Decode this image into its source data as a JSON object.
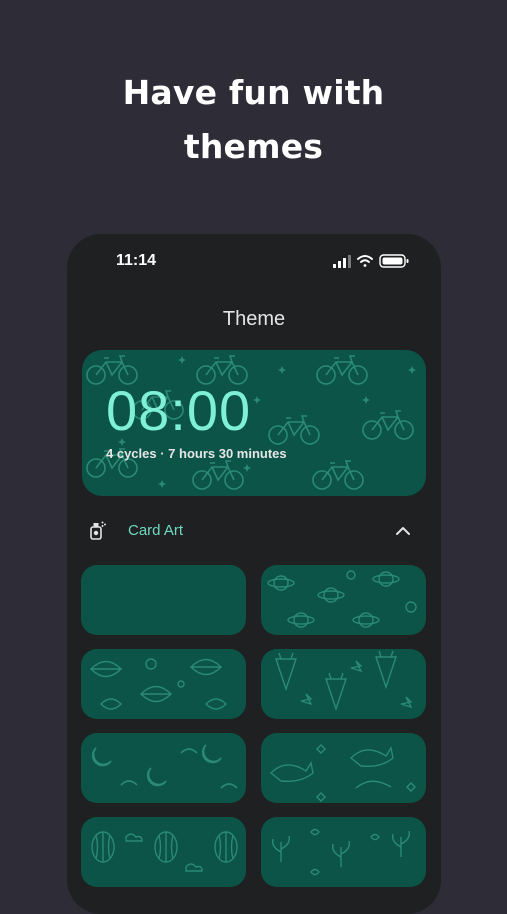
{
  "headline": {
    "line1": "Have fun with",
    "line2": "themes"
  },
  "status_bar": {
    "time": "11:14",
    "icons": [
      "signal-icon",
      "wifi-icon",
      "battery-icon"
    ]
  },
  "screen": {
    "title": "Theme"
  },
  "preview_card": {
    "time": "08:00",
    "subtitle": "4 cycles · 7 hours 30 minutes",
    "pattern": "bicycle"
  },
  "section": {
    "label": "Card Art",
    "icon": "spray-can-icon",
    "toggle_icon": "chevron-up-icon",
    "expanded": true
  },
  "card_art_options": [
    {
      "pattern": "plain"
    },
    {
      "pattern": "planets"
    },
    {
      "pattern": "leaves"
    },
    {
      "pattern": "carrots"
    },
    {
      "pattern": "moons"
    },
    {
      "pattern": "cats"
    },
    {
      "pattern": "balloons"
    },
    {
      "pattern": "plants"
    }
  ],
  "colors": {
    "background": "#2e2d37",
    "phone": "#1f2021",
    "card": "#0b5447",
    "pattern": "#2a8a75",
    "accent": "#6fd9bf",
    "time": "#7ff0d6"
  }
}
